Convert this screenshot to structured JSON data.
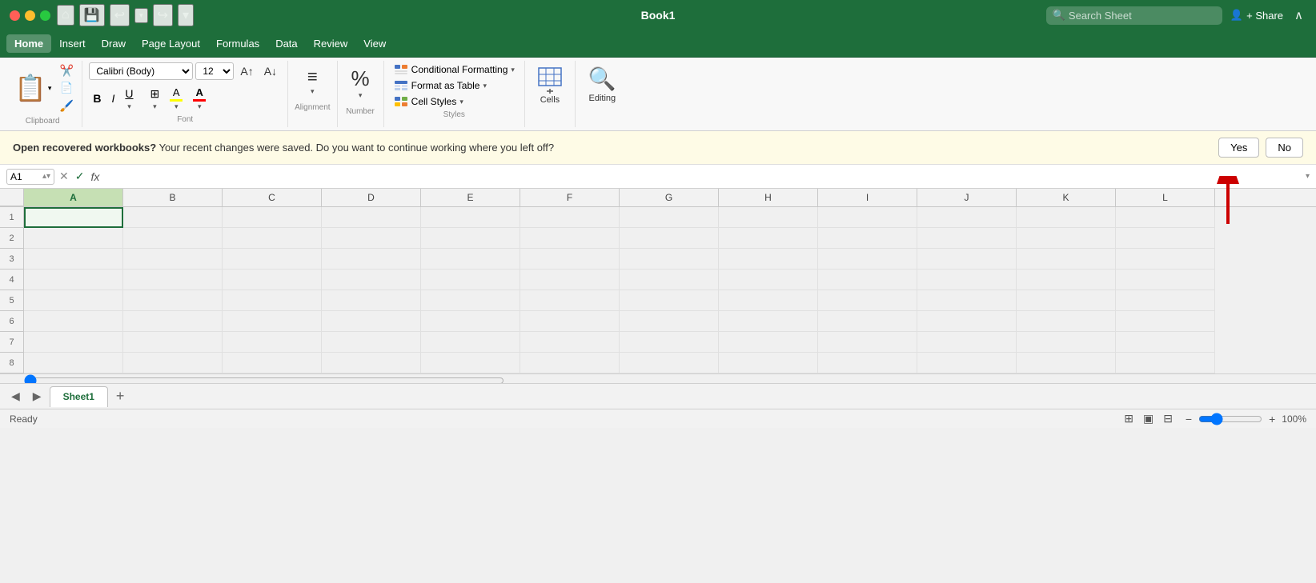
{
  "app": {
    "title": "Book1",
    "search_placeholder": "Search Sheet"
  },
  "title_bar": {
    "quick_access": [
      "home-icon",
      "save-icon",
      "undo-icon",
      "redo-icon",
      "customize-icon"
    ]
  },
  "menu": {
    "items": [
      "Home",
      "Insert",
      "Draw",
      "Page Layout",
      "Formulas",
      "Data",
      "Review",
      "View"
    ],
    "active": "Home",
    "share_label": "+ Share"
  },
  "ribbon": {
    "paste_label": "Paste",
    "clipboard_label": "Clipboard",
    "font_name": "Calibri (Body)",
    "font_size": "12",
    "bold_label": "B",
    "italic_label": "I",
    "underline_label": "U",
    "font_group_label": "Font",
    "alignment_label": "Alignment",
    "number_label": "Number",
    "conditional_formatting_label": "Conditional Formatting",
    "format_as_table_label": "Format as Table",
    "cell_styles_label": "Cell Styles",
    "styles_label": "Styles",
    "cells_label": "Cells",
    "editing_label": "Editing"
  },
  "notification": {
    "bold_text": "Open recovered workbooks?",
    "regular_text": " Your recent changes were saved. Do you want to continue working where you left off?",
    "yes_label": "Yes",
    "no_label": "No"
  },
  "formula_bar": {
    "cell_ref": "A1",
    "fx_label": "fx",
    "cancel_icon": "✕",
    "confirm_icon": "✓",
    "formula_value": ""
  },
  "spreadsheet": {
    "columns": [
      "A",
      "B",
      "C",
      "D",
      "E",
      "F",
      "G",
      "H",
      "I",
      "J",
      "K",
      "L"
    ],
    "rows": [
      "1",
      "2",
      "3",
      "4",
      "5",
      "6",
      "7",
      "8"
    ],
    "selected_cell": "A1"
  },
  "sheet_tabs": {
    "tabs": [
      "Sheet1"
    ],
    "active": "Sheet1",
    "add_label": "+"
  },
  "status_bar": {
    "ready_label": "Ready",
    "zoom_label": "100%"
  }
}
